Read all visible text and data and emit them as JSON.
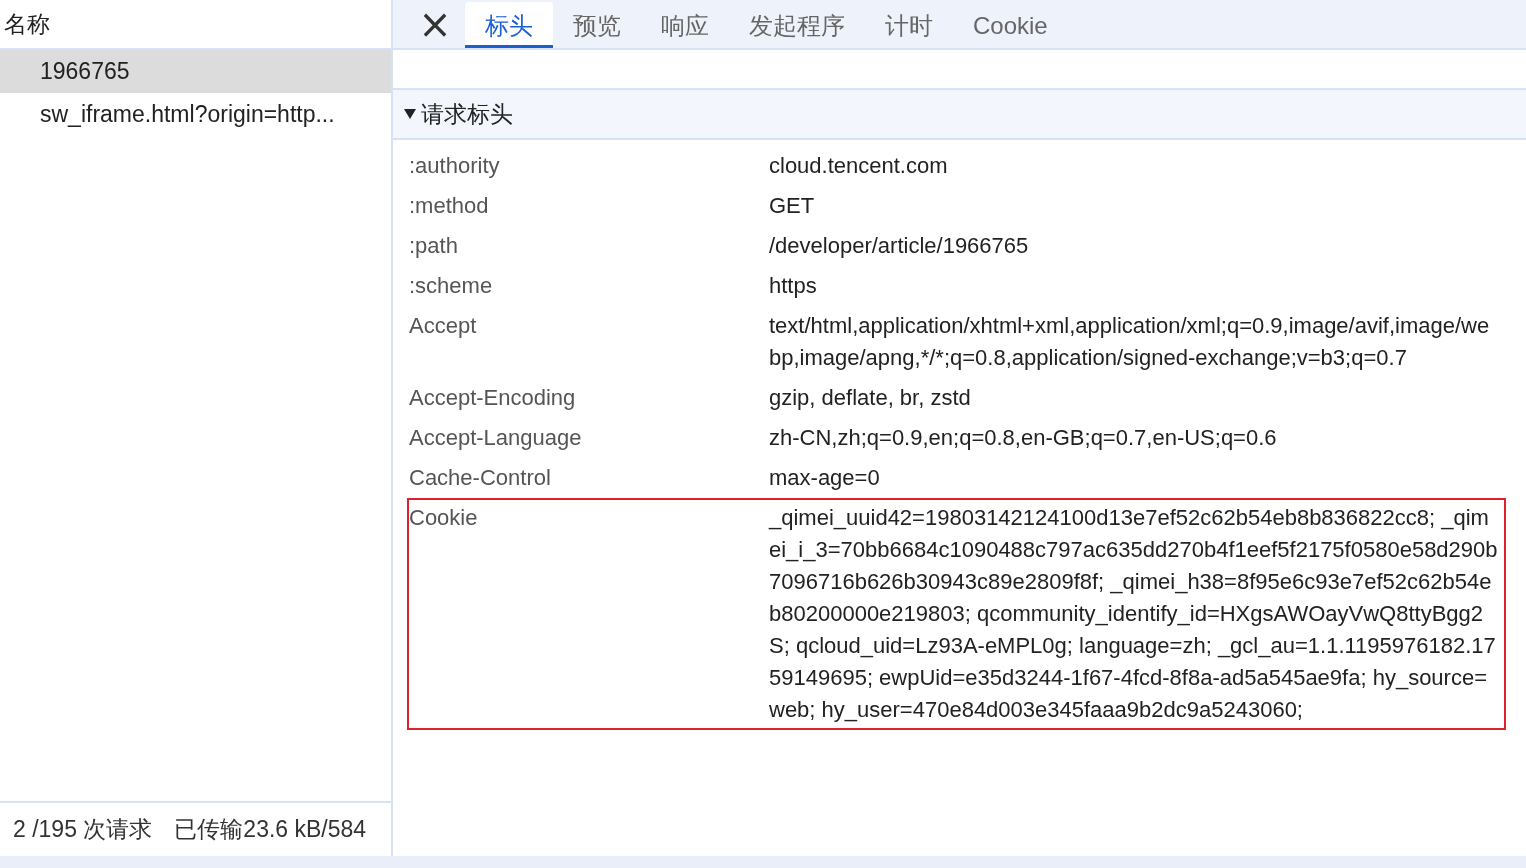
{
  "request_list": {
    "header": "名称",
    "items": [
      {
        "name": "1966765",
        "selected": true
      },
      {
        "name": "sw_iframe.html?origin=http...",
        "selected": false
      }
    ],
    "status_bar": {
      "requests": "2 /195 次请求",
      "transferred": "已传输23.6 kB/584"
    }
  },
  "details": {
    "close": "×",
    "tabs": [
      {
        "label": "标头",
        "selected": true
      },
      {
        "label": "预览",
        "selected": false
      },
      {
        "label": "响应",
        "selected": false
      },
      {
        "label": "发起程序",
        "selected": false
      },
      {
        "label": "计时",
        "selected": false
      },
      {
        "label": "Cookie",
        "selected": false
      }
    ],
    "section": {
      "title": "请求标头",
      "expanded": true,
      "headers": [
        {
          "name": ":authority",
          "value": "cloud.tencent.com",
          "highlighted": false
        },
        {
          "name": ":method",
          "value": "GET",
          "highlighted": false
        },
        {
          "name": ":path",
          "value": "/developer/article/1966765",
          "highlighted": false
        },
        {
          "name": ":scheme",
          "value": "https",
          "highlighted": false
        },
        {
          "name": "Accept",
          "value": "text/html,application/xhtml+xml,application/xml;q=0.9,image/avif,image/webp,image/apng,*/*;q=0.8,application/signed-exchange;v=b3;q=0.7",
          "highlighted": false
        },
        {
          "name": "Accept-Encoding",
          "value": "gzip, deflate, br, zstd",
          "highlighted": false
        },
        {
          "name": "Accept-Language",
          "value": "zh-CN,zh;q=0.9,en;q=0.8,en-GB;q=0.7,en-US;q=0.6",
          "highlighted": false
        },
        {
          "name": "Cache-Control",
          "value": "max-age=0",
          "highlighted": false
        },
        {
          "name": "Cookie",
          "value": "_qimei_uuid42=19803142124100d13e7ef52c62b54eb8b836822cc8; _qimei_i_3=70bb6684c1090488c797ac635dd270b4f1eef5f2175f0580e58d290b7096716b626b30943c89e2809f8f; _qimei_h38=8f95e6c93e7ef52c62b54eb80200000e219803; qcommunity_identify_id=HXgsAWOayVwQ8ttyBgg2S; qcloud_uid=Lz93A-eMPL0g; language=zh; _gcl_au=1.1.1195976182.1759149695; ewpUid=e35d3244-1f67-4fcd-8f8a-ad5a545ae9fa; hy_source=web; hy_user=470e84d003e345faaa9b2dc9a5243060;",
          "highlighted": true
        }
      ]
    }
  }
}
